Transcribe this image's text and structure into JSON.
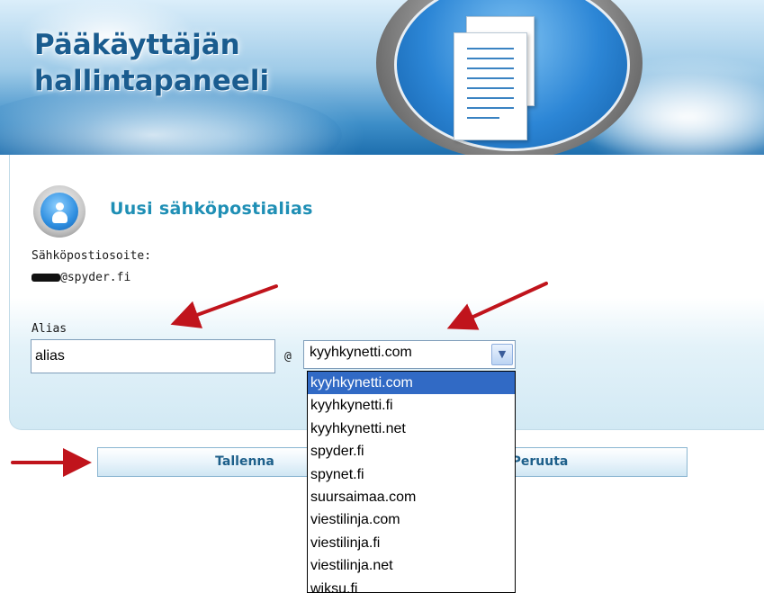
{
  "header": {
    "title_line1": "Pääkäyttäjän",
    "title_line2": "hallintapaneeli"
  },
  "section": {
    "title": "Uusi sähköpostialias"
  },
  "email": {
    "label": "Sähköpostiosoite:",
    "value": "@spyder.fi"
  },
  "alias": {
    "label": "Alias",
    "value": "alias",
    "at": "@"
  },
  "domain_select": {
    "selected": "kyyhkynetti.com",
    "options": [
      "kyyhkynetti.com",
      "kyyhkynetti.fi",
      "kyyhkynetti.net",
      "spyder.fi",
      "spynet.fi",
      "suursaimaa.com",
      "viestilinja.com",
      "viestilinja.fi",
      "viestilinja.net",
      "wiksu.fi"
    ]
  },
  "buttons": {
    "save": "Tallenna",
    "cancel": "Peruuta"
  },
  "colors": {
    "accent": "#1f8fb5",
    "annotation_arrow": "#c0141c",
    "selected_option": "#316ac5"
  },
  "icons": [
    "documents-icon",
    "user-info-icon",
    "chevron-down-icon",
    "annotation-arrow-icon"
  ]
}
